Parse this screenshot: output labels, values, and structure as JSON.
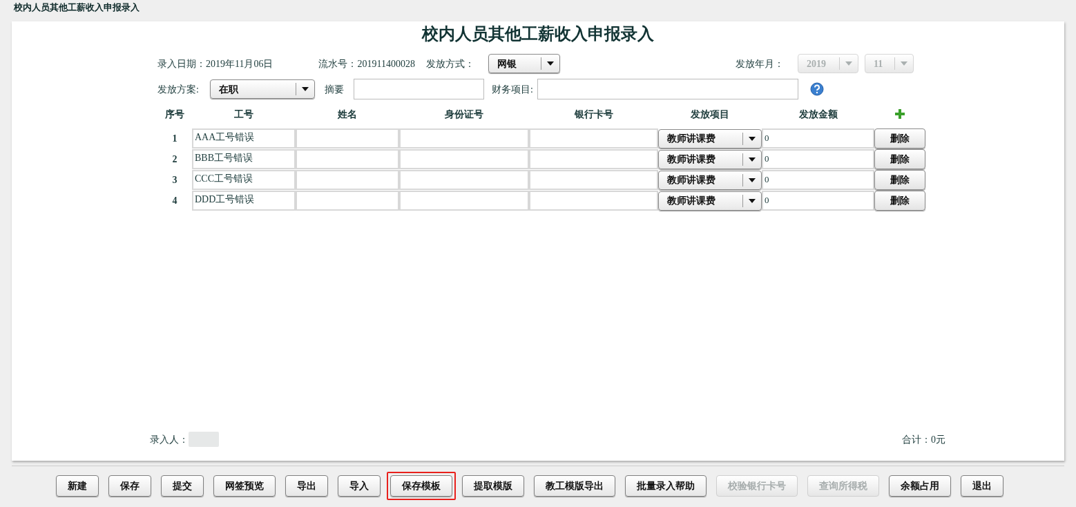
{
  "window": {
    "title": "校内人员其他工薪收入申报录入"
  },
  "form": {
    "heading": "校内人员其他工薪收入申报录入",
    "entry_date": {
      "label": "录入日期：",
      "value": "2019年11月06日"
    },
    "serial": {
      "label": "流水号：",
      "value": "201911400028"
    },
    "pay_method": {
      "label": "发放方式：",
      "value": "网银",
      "disabled": false
    },
    "pay_period": {
      "label": "发放年月：",
      "year": "2019",
      "month": "11",
      "disabled": true
    },
    "pay_plan": {
      "label": "发放方案:",
      "value": "在职",
      "disabled": false
    },
    "summary": {
      "label": "摘要"
    },
    "finance_item": {
      "label": "财务项目:"
    }
  },
  "table": {
    "columns": [
      "序号",
      "工号",
      "姓名",
      "身份证号",
      "银行卡号",
      "发放项目",
      "发放金额"
    ],
    "rows": [
      {
        "index": "1",
        "staff_id": "AAA工号错误",
        "item": "教师讲课费",
        "amount": "0",
        "action": "删除"
      },
      {
        "index": "2",
        "staff_id": "BBB工号错误",
        "item": "教师讲课费",
        "amount": "0",
        "action": "删除"
      },
      {
        "index": "3",
        "staff_id": "CCC工号错误",
        "item": "教师讲课费",
        "amount": "0",
        "action": "删除"
      },
      {
        "index": "4",
        "staff_id": "DDD工号错误",
        "item": "教师讲课费",
        "amount": "0",
        "action": "删除"
      }
    ]
  },
  "footer": {
    "entered_by_label": "录入人：",
    "total": "合计：0元"
  },
  "buttons": [
    {
      "label": "新建",
      "disabled": false,
      "highlighted": false
    },
    {
      "label": "保存",
      "disabled": false,
      "highlighted": false
    },
    {
      "label": "提交",
      "disabled": false,
      "highlighted": false
    },
    {
      "label": "网签预览",
      "disabled": false,
      "highlighted": false
    },
    {
      "label": "导出",
      "disabled": false,
      "highlighted": false
    },
    {
      "label": "导入",
      "disabled": false,
      "highlighted": false
    },
    {
      "label": "保存模板",
      "disabled": false,
      "highlighted": true
    },
    {
      "label": "提取模版",
      "disabled": false,
      "highlighted": false
    },
    {
      "label": "教工模版导出",
      "disabled": false,
      "highlighted": false
    },
    {
      "label": "批量录入帮助",
      "disabled": false,
      "highlighted": false
    },
    {
      "label": "校验银行卡号",
      "disabled": true,
      "highlighted": false
    },
    {
      "label": "查询所得税",
      "disabled": true,
      "highlighted": false
    },
    {
      "label": "余额占用",
      "disabled": false,
      "highlighted": false
    },
    {
      "label": "退出",
      "disabled": false,
      "highlighted": false
    }
  ]
}
